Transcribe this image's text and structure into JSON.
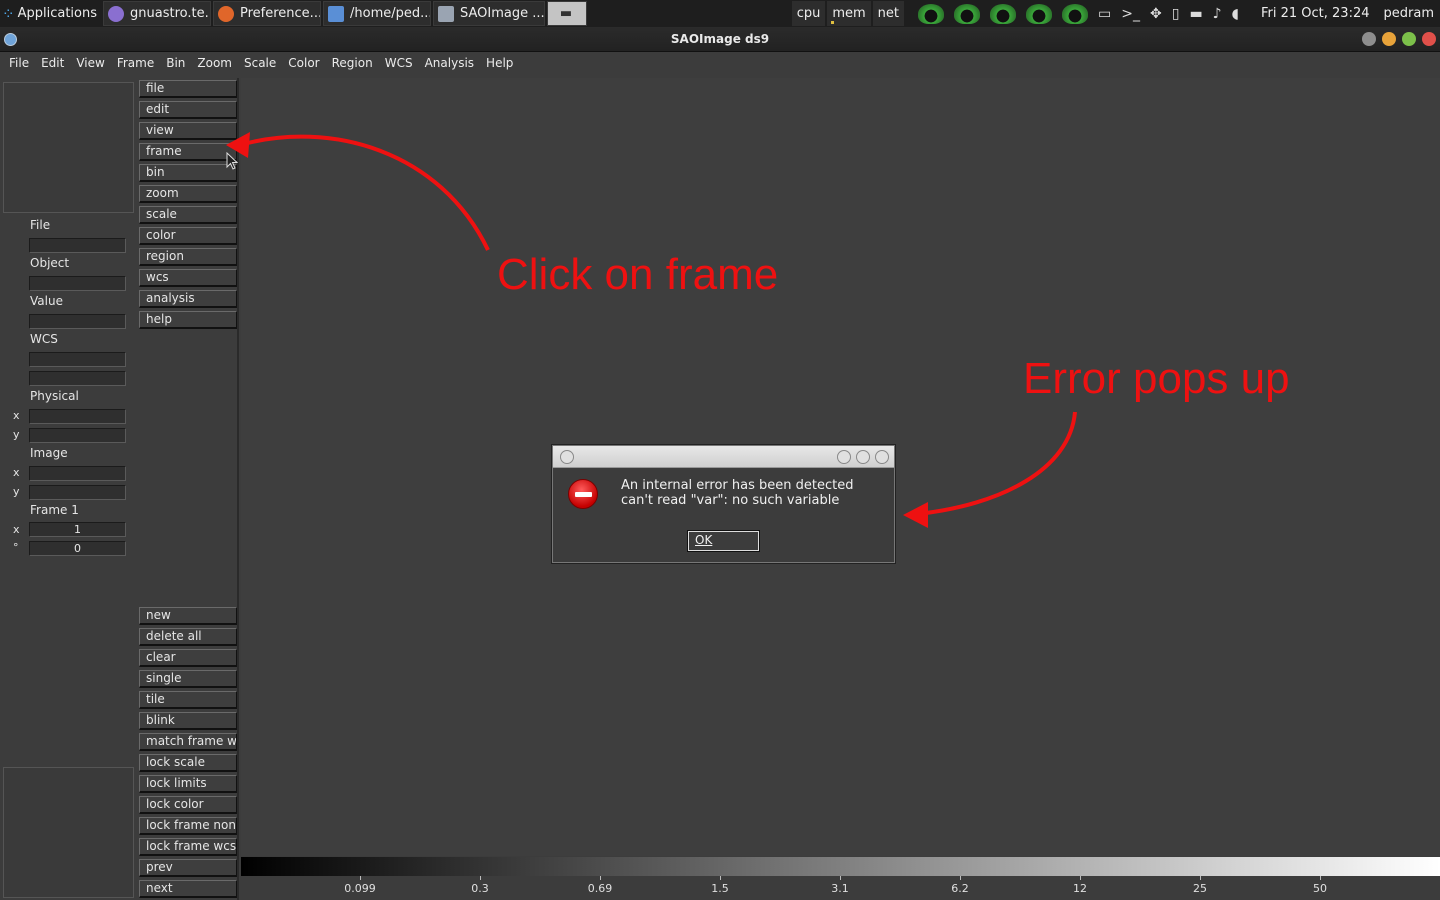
{
  "taskbar": {
    "apps_label": "Applications",
    "tasks": [
      {
        "label": "gnuastro.te...",
        "icon_color": "#8a6fd0"
      },
      {
        "label": "Preference...",
        "icon_color": "#e0662a"
      },
      {
        "label": "/home/ped...",
        "icon_color": "#5a8fd6"
      },
      {
        "label": "SAOImage ...",
        "icon_color": "#9aa4b2"
      }
    ],
    "monitors": [
      "cpu",
      "mem",
      "net"
    ],
    "clock": "Fri 21 Oct, 23:24",
    "user": "pedram"
  },
  "window": {
    "title": "SAOImage ds9"
  },
  "menubar": [
    "File",
    "Edit",
    "View",
    "Frame",
    "Bin",
    "Zoom",
    "Scale",
    "Color",
    "Region",
    "WCS",
    "Analysis",
    "Help"
  ],
  "info_panel": {
    "file_label": "File",
    "object_label": "Object",
    "value_label": "Value",
    "wcs_label": "WCS",
    "physical_label": "Physical",
    "image_label": "Image",
    "frame_label": "Frame 1",
    "x_letter": "x",
    "y_letter": "y",
    "deg_letter": "°",
    "frame_zoom_value": "1",
    "frame_angle_value": "0"
  },
  "buttonbar_top": [
    "file",
    "edit",
    "view",
    "frame",
    "bin",
    "zoom",
    "scale",
    "color",
    "region",
    "wcs",
    "analysis",
    "help"
  ],
  "buttonbar_bottom": [
    "new",
    "delete all",
    "clear",
    "single",
    "tile",
    "blink",
    "match frame wc",
    "lock scale",
    "lock limits",
    "lock color",
    "lock frame none",
    "lock frame wcs",
    "prev",
    "next"
  ],
  "colorbar": {
    "ticks": [
      "0.099",
      "0.3",
      "0.69",
      "1.5",
      "3.1",
      "6.2",
      "12",
      "25",
      "50"
    ]
  },
  "annotations": {
    "click_on_frame": "Click on frame",
    "error_pops_up": "Error pops up"
  },
  "dialog": {
    "message": "An internal error has been detected can't read \"var\": no such variable",
    "ok_label": "OK"
  },
  "colors": {
    "annotation": "#ee1111",
    "background": "#3c3c3c"
  }
}
